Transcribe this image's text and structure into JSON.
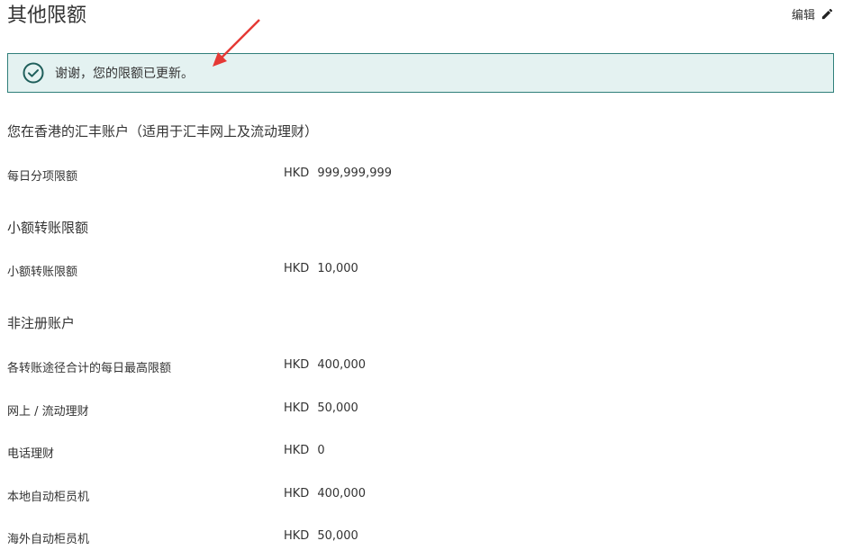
{
  "header": {
    "title": "其他限额",
    "edit_label": "编辑"
  },
  "banner": {
    "message": "谢谢，您的限额已更新。"
  },
  "sections": [
    {
      "title": "您在香港的汇丰账户（适用于汇丰网上及流动理财）",
      "rows": [
        {
          "label": "每日分项限额",
          "currency": "HKD",
          "amount": "999,999,999"
        }
      ]
    },
    {
      "title": "小额转账限额",
      "rows": [
        {
          "label": "小额转账限额",
          "currency": "HKD",
          "amount": "10,000"
        }
      ]
    },
    {
      "title": "非注册账户",
      "rows": [
        {
          "label": "各转账途径合计的每日最高限额",
          "currency": "HKD",
          "amount": "400,000"
        },
        {
          "label": "网上 / 流动理财",
          "currency": "HKD",
          "amount": "50,000"
        },
        {
          "label": "电话理财",
          "currency": "HKD",
          "amount": "0"
        },
        {
          "label": "本地自动柜员机",
          "currency": "HKD",
          "amount": "400,000"
        },
        {
          "label": "海外自动柜员机",
          "currency": "HKD",
          "amount": "50,000"
        }
      ]
    }
  ],
  "colors": {
    "banner_border": "#2f7f7a",
    "banner_bg": "#e4f2f1",
    "annotation_arrow": "#e53935"
  }
}
